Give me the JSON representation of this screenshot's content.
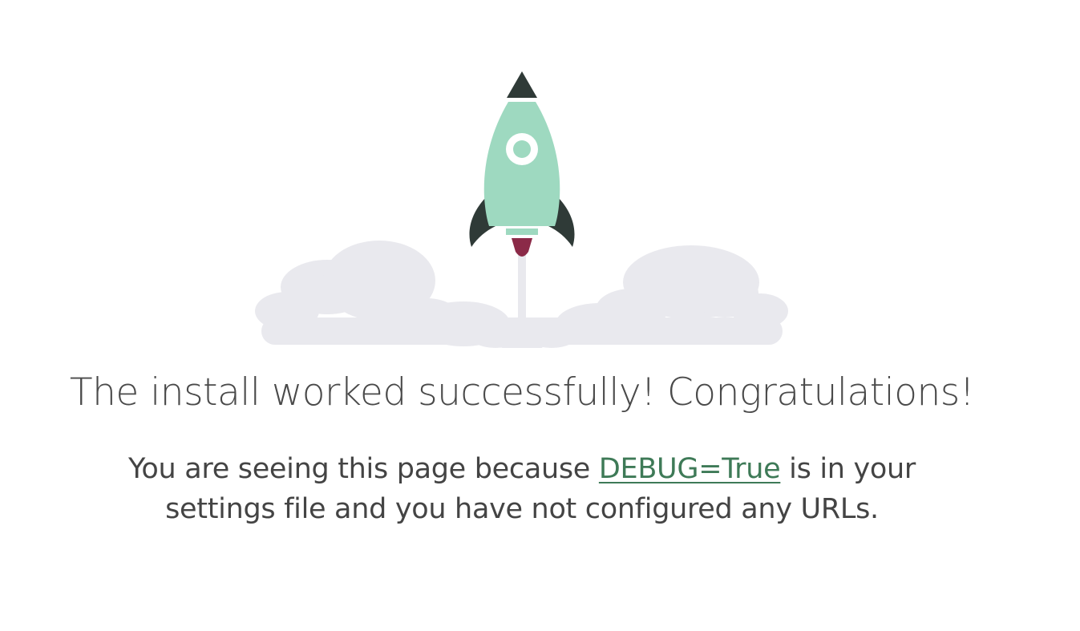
{
  "colors": {
    "rocket_body": "#9ed9c0",
    "rocket_dark": "#2f3a37",
    "flame": "#8b2a48",
    "cloud": "#e9e9ee",
    "trail": "#e9e9ee",
    "link": "#3e7a57",
    "text": "#444444"
  },
  "illustration": {
    "icons": [
      "rocket-icon",
      "clouds-icon"
    ]
  },
  "headline": "The install worked successfully! Congratulations!",
  "message": {
    "before_link": "You are seeing this page because ",
    "link_text": "DEBUG=True",
    "after_link": " is in your settings file and you have not configured any URLs."
  }
}
